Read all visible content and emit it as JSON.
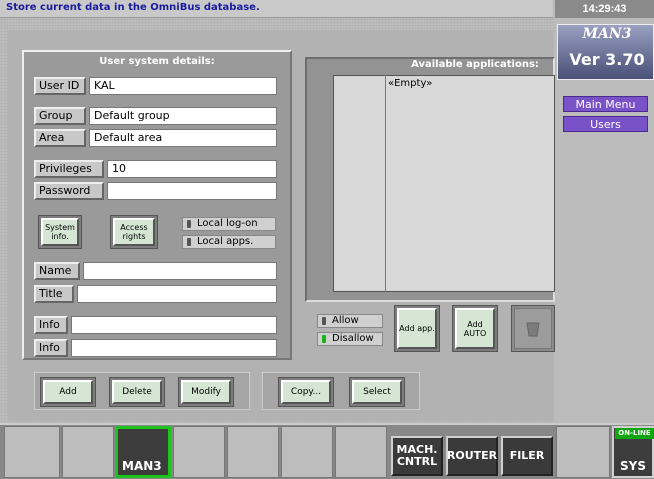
{
  "status_message": "Store current data in the OmniBus database.",
  "clock": "14:29:43",
  "logo": {
    "title": "MAN3",
    "version": "Ver 3.70"
  },
  "menu": [
    "Main Menu",
    "Users"
  ],
  "details": {
    "title": "User system details:",
    "fields": {
      "user_id": {
        "label": "User ID",
        "value": "KAL"
      },
      "group": {
        "label": "Group",
        "value": "Default group"
      },
      "area": {
        "label": "Area",
        "value": "Default area"
      },
      "privileges": {
        "label": "Privileges",
        "value": "10"
      },
      "password": {
        "label": "Password",
        "value": ""
      },
      "name": {
        "label": "Name",
        "value": ""
      },
      "title": {
        "label": "Title",
        "value": ""
      },
      "info1": {
        "label": "Info",
        "value": ""
      },
      "info2": {
        "label": "Info",
        "value": ""
      }
    },
    "buttons": {
      "system_info": "System info.",
      "access_rights": "Access rights"
    },
    "toggles": {
      "local_logon": "Local log-on",
      "local_apps": "Local apps."
    }
  },
  "apps": {
    "title": "Available applications:",
    "empty_text": "«Empty»",
    "toggles": {
      "allow": "Allow",
      "disallow": "Disallow"
    },
    "buttons": {
      "add_app": "Add app.",
      "add_auto": "Add AUTO"
    }
  },
  "actions": {
    "add": "Add",
    "delete": "Delete",
    "modify": "Modify",
    "copy": "Copy...",
    "select": "Select"
  },
  "bottom": {
    "man3": "MAN3",
    "mach_cntrl": "MACH. CNTRL",
    "router": "ROUTER",
    "filer": "FILER",
    "online": "ON-LINE",
    "sys": "SYS"
  },
  "colors": {
    "accent_green": "#1ec41e",
    "menu_purple": "#7a52c8",
    "status_blue": "#1a1aa0"
  }
}
